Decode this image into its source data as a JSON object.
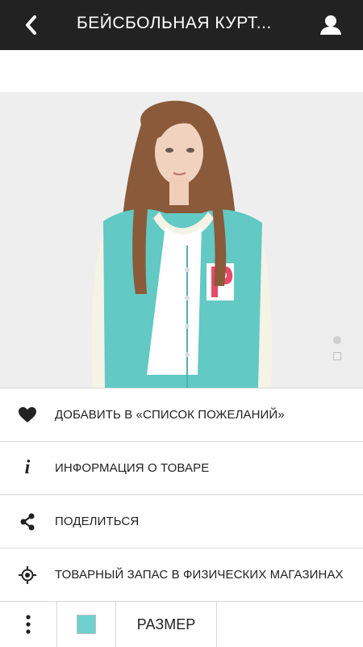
{
  "header": {
    "title": "БЕЙСБОЛЬНАЯ КУРТ...",
    "back_icon": "chevron-left-icon",
    "user_icon": "user-icon"
  },
  "gallery": {
    "image": "model wearing turquoise varsity jacket with P patch",
    "page_indicator": [
      "dot-active",
      "square-inactive"
    ]
  },
  "menu": [
    {
      "icon": "heart-icon",
      "label": "ДОБАВИТЬ В «СПИСОК ПОЖЕЛАНИЙ»"
    },
    {
      "icon": "info-icon",
      "label": "ИНФОРМАЦИЯ О ТОВАРЕ"
    },
    {
      "icon": "share-icon",
      "label": "ПОДЕЛИТЬСЯ"
    },
    {
      "icon": "locate-icon",
      "label": "ТОВАРНЫЙ ЗАПАС В ФИЗИЧЕСКИХ МАГАЗИНАХ"
    }
  ],
  "bottom_bar": {
    "more_icon": "more-vertical-icon",
    "swatch_color": "#6fd0d0",
    "size_label": "РАЗМЕР"
  },
  "colors": {
    "header_bg": "#222222",
    "jacket": "#62c9c4",
    "patch": "#e84a6a"
  }
}
